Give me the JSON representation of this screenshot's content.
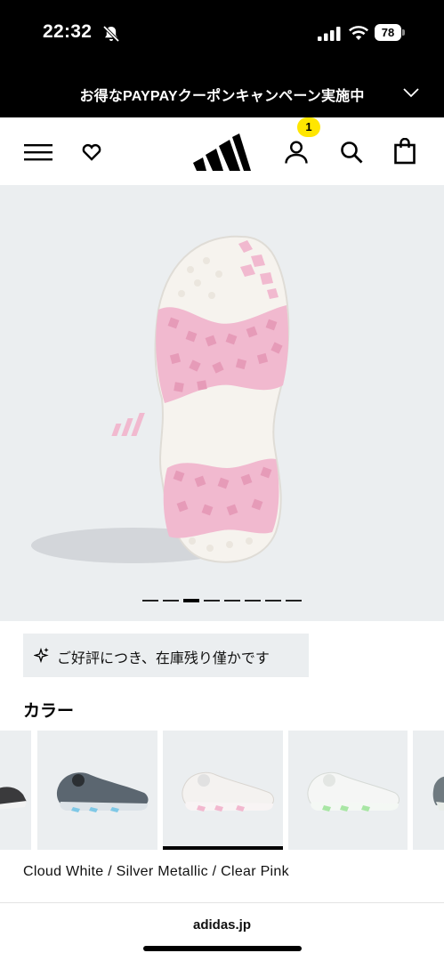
{
  "status_bar": {
    "time": "22:32",
    "battery": "78",
    "icons": [
      "bell-off-icon",
      "signal-icon",
      "wifi-icon",
      "battery-icon"
    ]
  },
  "promo": {
    "text": "お得なPAYPAYクーポンキャンペーン実施中",
    "icon": "chevron-down-icon"
  },
  "header": {
    "account_badge": "1",
    "icons": [
      "menu-icon",
      "wishlist-heart-icon",
      "adidas-logo",
      "account-icon",
      "search-icon",
      "bag-icon"
    ]
  },
  "gallery": {
    "total_images": 8,
    "active_index": 3
  },
  "stock_notice": {
    "text": "ご好評につき、在庫残り僅かです",
    "icon": "sparkle-icon"
  },
  "colors": {
    "heading": "カラー",
    "selected_name": "Cloud White / Silver Metallic / Clear Pink",
    "swatch_count": 6,
    "selected_index": 2
  },
  "browser": {
    "url": "adidas.jp"
  },
  "theme": {
    "brand_black": "#000000",
    "badge_yellow": "#ffe600",
    "panel_grey": "#ebeef0",
    "sole_pink": "#f2b8cf"
  }
}
